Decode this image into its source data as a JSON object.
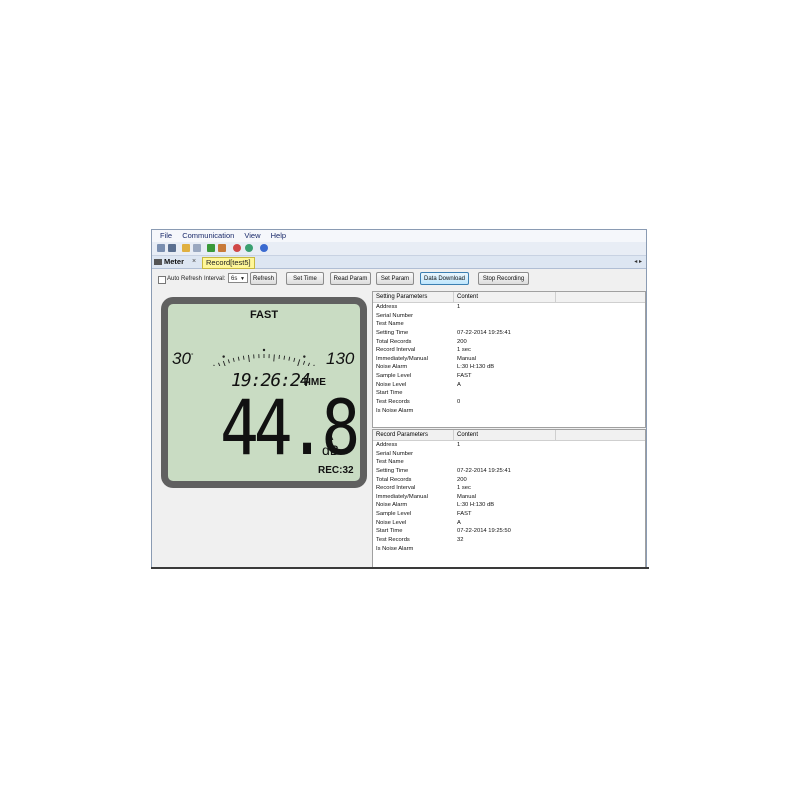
{
  "menu": [
    "File",
    "Communication",
    "View",
    "Help"
  ],
  "toolbar_icons": [
    "open-icon",
    "save-icon",
    "folder-icon",
    "export-icon",
    "print-icon",
    "copy-icon",
    "refresh-icon",
    "connect-icon",
    "help-icon"
  ],
  "tabs": {
    "meter": "Meter",
    "record": "Record[test5]",
    "close": "×",
    "nav": "◂ ▸"
  },
  "controls": {
    "auto_refresh": "Auto Refresh",
    "interval_label": "Interval:",
    "interval_value": "6s",
    "refresh": "Refresh",
    "set_time": "Set Time",
    "read_param": "Read Param",
    "set_param": "Set Param",
    "data_download": "Data Download",
    "stop_recording": "Stop Recording"
  },
  "lcd": {
    "mode": "FAST",
    "scale_min": "30",
    "scale_max": "130",
    "time": "19:26:24",
    "time_label": "TIME",
    "reading": "44.8",
    "weighting": "A",
    "unit": "dB",
    "rec_label": "REC:32",
    "bar_level_fraction": 0.1
  },
  "setting_panel": {
    "col1": "Setting Parameters",
    "col2": "Content",
    "rows": [
      {
        "k": "Address",
        "v": "1"
      },
      {
        "k": "Serial Number",
        "v": ""
      },
      {
        "k": "Test Name",
        "v": ""
      },
      {
        "k": "Setting Time",
        "v": "07-22-2014 19:25:41"
      },
      {
        "k": "Total Records",
        "v": "200"
      },
      {
        "k": "Record Interval",
        "v": "1 sec"
      },
      {
        "k": "Immediately/Manual",
        "v": "Manual"
      },
      {
        "k": "Noise Alarm",
        "v": "L:30 H:130 dB"
      },
      {
        "k": "Sample Level",
        "v": "FAST"
      },
      {
        "k": "Noise Level",
        "v": "A"
      },
      {
        "k": "Start Time",
        "v": ""
      },
      {
        "k": "Test Records",
        "v": "0"
      },
      {
        "k": "Is Noise Alarm",
        "v": ""
      }
    ]
  },
  "record_panel": {
    "col1": "Record Parameters",
    "col2": "Content",
    "rows": [
      {
        "k": "Address",
        "v": "1"
      },
      {
        "k": "Serial Number",
        "v": ""
      },
      {
        "k": "Test Name",
        "v": ""
      },
      {
        "k": "Setting Time",
        "v": "07-22-2014 19:25:41"
      },
      {
        "k": "Total Records",
        "v": "200"
      },
      {
        "k": "Record Interval",
        "v": "1 sec"
      },
      {
        "k": "Immediately/Manual",
        "v": "Manual"
      },
      {
        "k": "Noise Alarm",
        "v": "L:30 H:130 dB"
      },
      {
        "k": "Sample Level",
        "v": "FAST"
      },
      {
        "k": "Noise Level",
        "v": "A"
      },
      {
        "k": "Start Time",
        "v": "07-22-2014 19:25:50"
      },
      {
        "k": "Test Records",
        "v": "32"
      },
      {
        "k": "Is Noise Alarm",
        "v": ""
      }
    ]
  },
  "colors": {
    "lcd_bg": "#c9dcc3",
    "lcd_frame": "#606060",
    "record_tab": "#fff799",
    "active_button": "#bee6fd"
  }
}
